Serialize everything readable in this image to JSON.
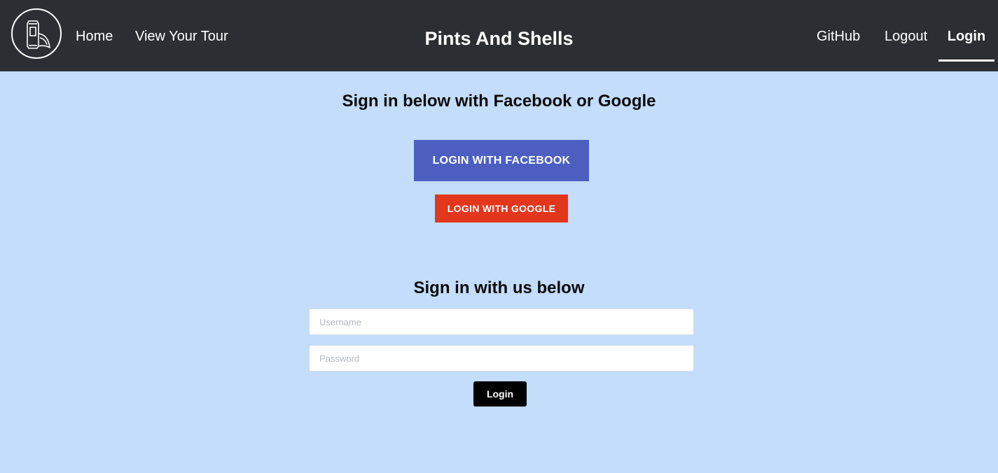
{
  "navbar": {
    "logo_icon": "beer-can-taco-logo-icon",
    "links_left": [
      "Home",
      "View Your Tour"
    ],
    "brand": "Pints And Shells",
    "links_right": [
      "GitHub",
      "Logout",
      "Login"
    ],
    "active_link": "Login",
    "background": "#2b2f33"
  },
  "social": {
    "heading": "Sign in below with Facebook or Google",
    "facebook_label": "Login with Facebook",
    "google_label": "Login with Google",
    "facebook_color": "#4c5fc1",
    "google_color": "#e2361d"
  },
  "local": {
    "heading": "Sign in with us below",
    "username_placeholder": "Username",
    "password_placeholder": "Password",
    "submit_label": "Login"
  },
  "page": {
    "background": "#c3ddfb"
  }
}
